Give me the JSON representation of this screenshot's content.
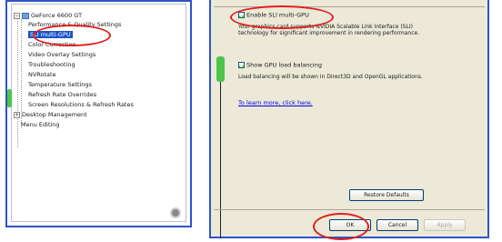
{
  "tree": {
    "root_label": "GeForce 6600 GT",
    "items": [
      "Performance & Quality Settings",
      "SLI multi-GPU",
      "Color Correction",
      "Video Overlay Settings",
      "Troubleshooting",
      "NVRotate",
      "Temperature Settings",
      "Refresh Rate Overrides",
      "Screen Resolutions & Refresh Rates"
    ],
    "desktop_management": "Desktop Management",
    "menu_editing": "Menu Editing"
  },
  "sli": {
    "enable_label": "Enable SLI multi-GPU",
    "enable_desc_line1": "Your graphics card supports NVIDIA Scalable Link Interface (SLI)",
    "enable_desc_line2": "technology for significant improvement in rendering performance.",
    "show_load_label": "Show GPU load balancing",
    "show_load_desc": "Load balancing will be shown in Direct3D and OpenGL applications.",
    "learn_more": "To learn more, click here."
  },
  "buttons": {
    "restore": "Restore Defaults",
    "ok": "OK",
    "cancel": "Cancel",
    "apply": "Apply"
  },
  "colors": {
    "highlight": "#e02020",
    "marker": "#4cc64a",
    "selection": "#1c54c8"
  }
}
